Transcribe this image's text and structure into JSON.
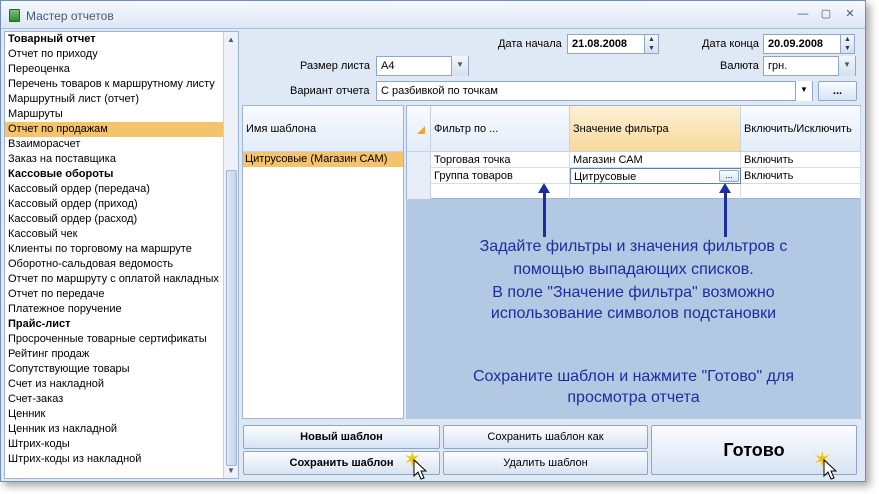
{
  "window": {
    "title": "Мастер отчетов"
  },
  "sidebar": {
    "items": [
      {
        "label": "Товарный отчет",
        "bold": true
      },
      {
        "label": "Отчет по приходу"
      },
      {
        "label": "Переоценка"
      },
      {
        "label": "Перечень товаров к маршрутному листу"
      },
      {
        "label": "Маршрутный лист (отчет)"
      },
      {
        "label": "Маршруты"
      },
      {
        "label": "Отчет по продажам",
        "selected": true
      },
      {
        "label": "Взаиморасчет"
      },
      {
        "label": "Заказ на поставщика"
      },
      {
        "label": "Кассовые обороты",
        "bold": true
      },
      {
        "label": "Кассовый ордер (передача)"
      },
      {
        "label": "Кассовый ордер (приход)"
      },
      {
        "label": "Кассовый ордер (расход)"
      },
      {
        "label": "Кассовый чек"
      },
      {
        "label": "Клиенты по торговому на маршруте"
      },
      {
        "label": "Оборотно-сальдовая ведомость"
      },
      {
        "label": "Отчет по маршруту с оплатой накладных"
      },
      {
        "label": "Отчет по передаче"
      },
      {
        "label": "Платежное поручение"
      },
      {
        "label": "Прайс-лист",
        "bold": true
      },
      {
        "label": "Просроченные товарные сертификаты"
      },
      {
        "label": "Рейтинг продаж"
      },
      {
        "label": "Сопутствующие товары"
      },
      {
        "label": "Счет из накладной"
      },
      {
        "label": "Счет-заказ"
      },
      {
        "label": "Ценник"
      },
      {
        "label": "Ценник из накладной"
      },
      {
        "label": "Штрих-коды"
      },
      {
        "label": "Штрих-коды из накладной"
      }
    ]
  },
  "params": {
    "start_label": "Дата начала",
    "start_value": "21.08.2008",
    "end_label": "Дата конца",
    "end_value": "20.09.2008",
    "size_label": "Размер листа",
    "size_value": "A4",
    "currency_label": "Валюта",
    "currency_value": "грн.",
    "variant_label": "Вариант отчета",
    "variant_value": "С разбивкой по точкам",
    "more_button": "..."
  },
  "templates": {
    "header": "Имя шаблона",
    "rows": [
      "Цитрусовые (Магазин САМ)"
    ]
  },
  "filter_grid": {
    "headers": [
      "Фильтр по ...",
      "Значение фильтра",
      "Включить/Исключить"
    ],
    "rows": [
      {
        "filter": "Торговая точка",
        "value": "Магазин САМ",
        "mode": "Включить"
      },
      {
        "filter": "Группа товаров",
        "value": "Цитрусовые",
        "mode": "Включить"
      }
    ],
    "ellipsis": "..."
  },
  "hints": {
    "line1": "Задайте фильтры и значения фильтров с",
    "line2": "помощью выпадающих списков.",
    "line3": "В поле \"Значение фильтра\" возможно",
    "line4": "использование символов подстановки",
    "line5": "Сохраните шаблон и нажмите \"Готово\" для",
    "line6": "просмотра отчета"
  },
  "buttons": {
    "new_template": "Новый шаблон",
    "save_template_as": "Сохранить шаблон как",
    "save_template": "Сохранить шаблон",
    "delete_template": "Удалить шаблон",
    "done": "Готово"
  },
  "colors": {
    "accent": "#f5c36b",
    "hint_text": "#1b2e9e",
    "hint_bg": "#b3c8e3"
  }
}
